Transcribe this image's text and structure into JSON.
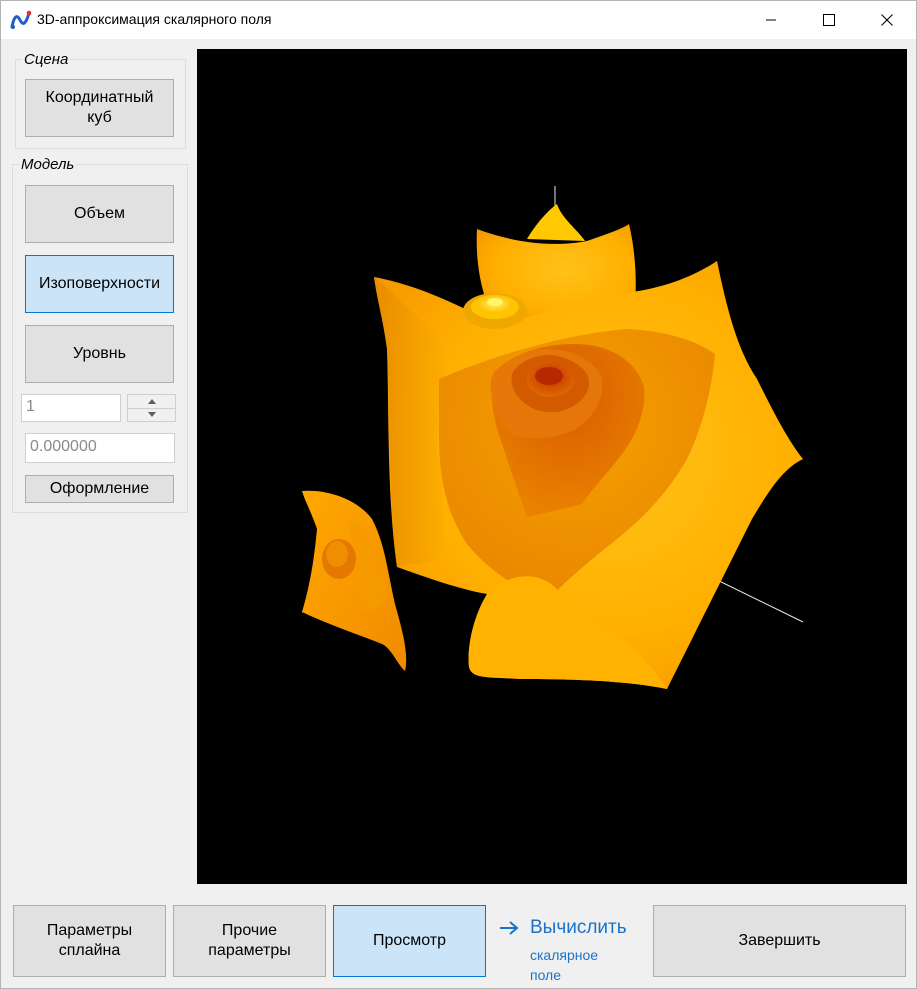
{
  "window": {
    "title": "3D-аппроксимация скалярного поля",
    "icon": "app-logo-icon",
    "controls": [
      "minimize-icon",
      "maximize-icon",
      "close-icon"
    ]
  },
  "scene_group": {
    "legend": "Сцена",
    "coord_cube_label": "Координатный\nкуб"
  },
  "model_group": {
    "legend": "Модель",
    "volume_label": "Объем",
    "isosurfaces_label": "Изоповерхности",
    "level_label": "Уровнь",
    "level_index_value": "1",
    "level_value": "0.000000",
    "style_label": "Оформление"
  },
  "viewport": {
    "background": "#000000",
    "surface_colors": [
      "#ffd21a",
      "#ffb400",
      "#f59a00",
      "#e07000",
      "#c84a00"
    ]
  },
  "bottom": {
    "spline_params_label": "Параметры\nсплайна",
    "other_params_label": "Прочие\nпараметры",
    "preview_label": "Просмотр",
    "compute_main": "Вычислить",
    "compute_sub": "скалярное поле",
    "finish_label": "Завершить"
  },
  "colors": {
    "active_button": "#cce4f7",
    "active_border": "#0078d7",
    "link": "#1a73c8"
  }
}
